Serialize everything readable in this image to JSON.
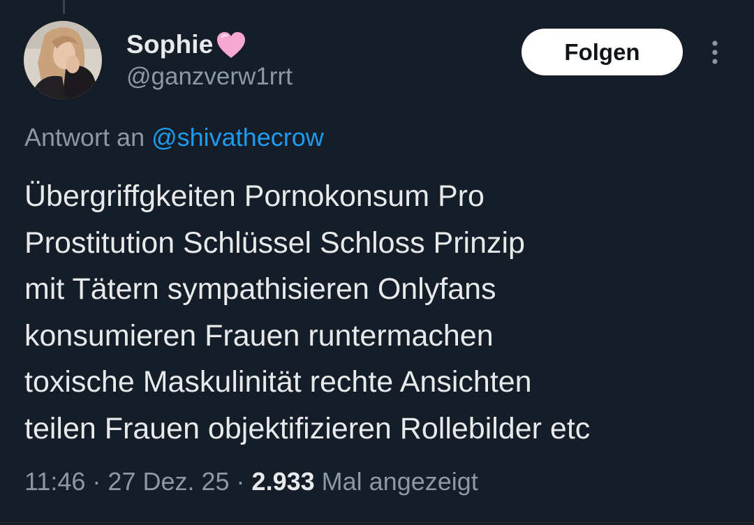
{
  "user": {
    "display_name": "Sophie",
    "handle": "@ganzverw1rrt",
    "badge_icon": "pink-heart-icon"
  },
  "actions": {
    "follow_label": "Folgen",
    "more_icon": "more-vertical-icon"
  },
  "reply": {
    "prefix": "Antwort an ",
    "handle": "@shivathecrow"
  },
  "tweet": {
    "lines": [
      "Übergriffgkeiten Pornokonsum Pro",
      "Prostitution Schlüssel Schloss Prinzip",
      "mit Tätern sympathisieren Onlyfans",
      "konsumieren Frauen runtermachen",
      "toxische Maskulinität rechte Ansichten",
      "teilen Frauen objektifizieren Rollebilder etc"
    ]
  },
  "meta": {
    "time": "11:46",
    "separator": " · ",
    "date": "27 Dez. 25",
    "views_count": "2.933",
    "views_label": " Mal angezeigt"
  },
  "colors": {
    "background": "#151d28",
    "text_primary": "#e7e9ea",
    "text_secondary": "#8b98a5",
    "link": "#1d9bf0",
    "heart": "#f7a8d0"
  }
}
